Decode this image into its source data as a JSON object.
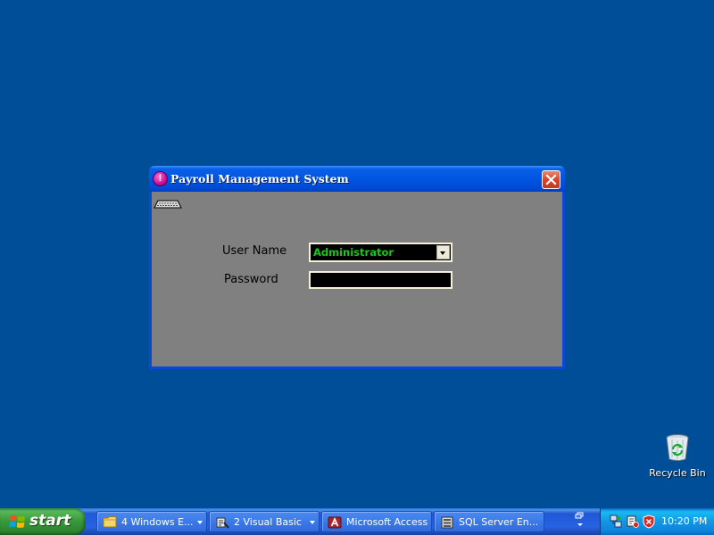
{
  "window": {
    "title": "Payroll Management System",
    "app_icon_glyph": "!",
    "icons": {
      "app": "payroll-app-icon",
      "close": "close-icon",
      "keyboard": "keyboard-icon"
    }
  },
  "login": {
    "username_label": "User Name",
    "username_value": "Administrator",
    "password_label": "Password",
    "password_value": "",
    "field_background": "#000000",
    "field_text_color": "#18c818"
  },
  "desktop": {
    "background": "#004e98",
    "icons": [
      {
        "label": "Recycle Bin",
        "icon": "recycle-bin-icon"
      }
    ]
  },
  "taskbar": {
    "start_label": "start",
    "tasks": [
      {
        "label": "4 Windows E...",
        "icon": "folder-icon",
        "grouped": true
      },
      {
        "label": "2 Visual Basic",
        "icon": "visual-basic-icon",
        "grouped": true
      },
      {
        "label": "Microsoft Access",
        "icon": "microsoft-access-icon",
        "grouped": false
      },
      {
        "label": "SQL Server En...",
        "icon": "sql-server-icon",
        "grouped": false
      }
    ],
    "tray_icons": [
      "network-icon",
      "security-center-icon",
      "antivirus-shield-icon"
    ],
    "clock": "10:20 PM"
  }
}
